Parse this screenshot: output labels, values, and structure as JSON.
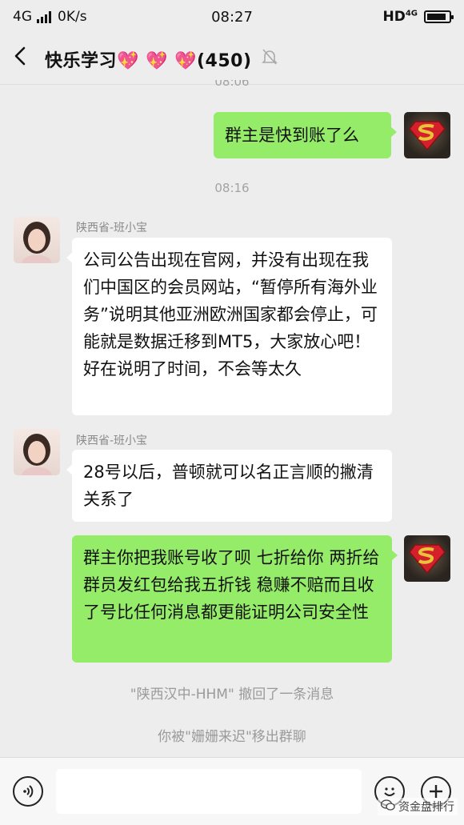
{
  "status_bar": {
    "network": "4G",
    "speed": "0K/s",
    "time": "08:27",
    "hd": "HD",
    "network_right": "4G",
    "battery_level": 0.9
  },
  "header": {
    "title": "快乐学习💖 💖 💖(450)",
    "back_icon": "chevron-left-icon",
    "mute_icon": "bell-off-icon"
  },
  "chat": {
    "top_time_partial": "08:06",
    "msg1": {
      "text": "群主是快到账了么",
      "side": "right"
    },
    "time2": "08:16",
    "msg2": {
      "sender": "陕西省-班小宝",
      "text": "公司公告出现在官网，并没有出现在我们中国区的会员网站，“暂停所有海外业务”说明其他亚洲欧洲国家都会停止，可能就是数据迁移到MT5，大家放心吧！好在说明了时间，不会等太久"
    },
    "msg3": {
      "sender": "陕西省-班小宝",
      "text": "28号以后，普顿就可以名正言顺的撇清关系了"
    },
    "msg4": {
      "text": "群主你把我账号收了呗 七折给你 两折给群员发红包给我五折钱 稳赚不赔而且收了号比任何消息都更能证明公司安全性",
      "side": "right"
    },
    "sys1": "\"陕西汉中-HHM\" 撤回了一条消息",
    "sys2": "你被\"姗姗来迟\"移出群聊"
  },
  "input_bar": {
    "voice_icon": "voice-icon",
    "emoji_icon": "smiley-icon",
    "add_icon": "plus-icon"
  },
  "watermark": "资金盘排行",
  "colors": {
    "background": "#ededed",
    "bubble_green": "#95ec69",
    "bubble_white": "#ffffff"
  }
}
